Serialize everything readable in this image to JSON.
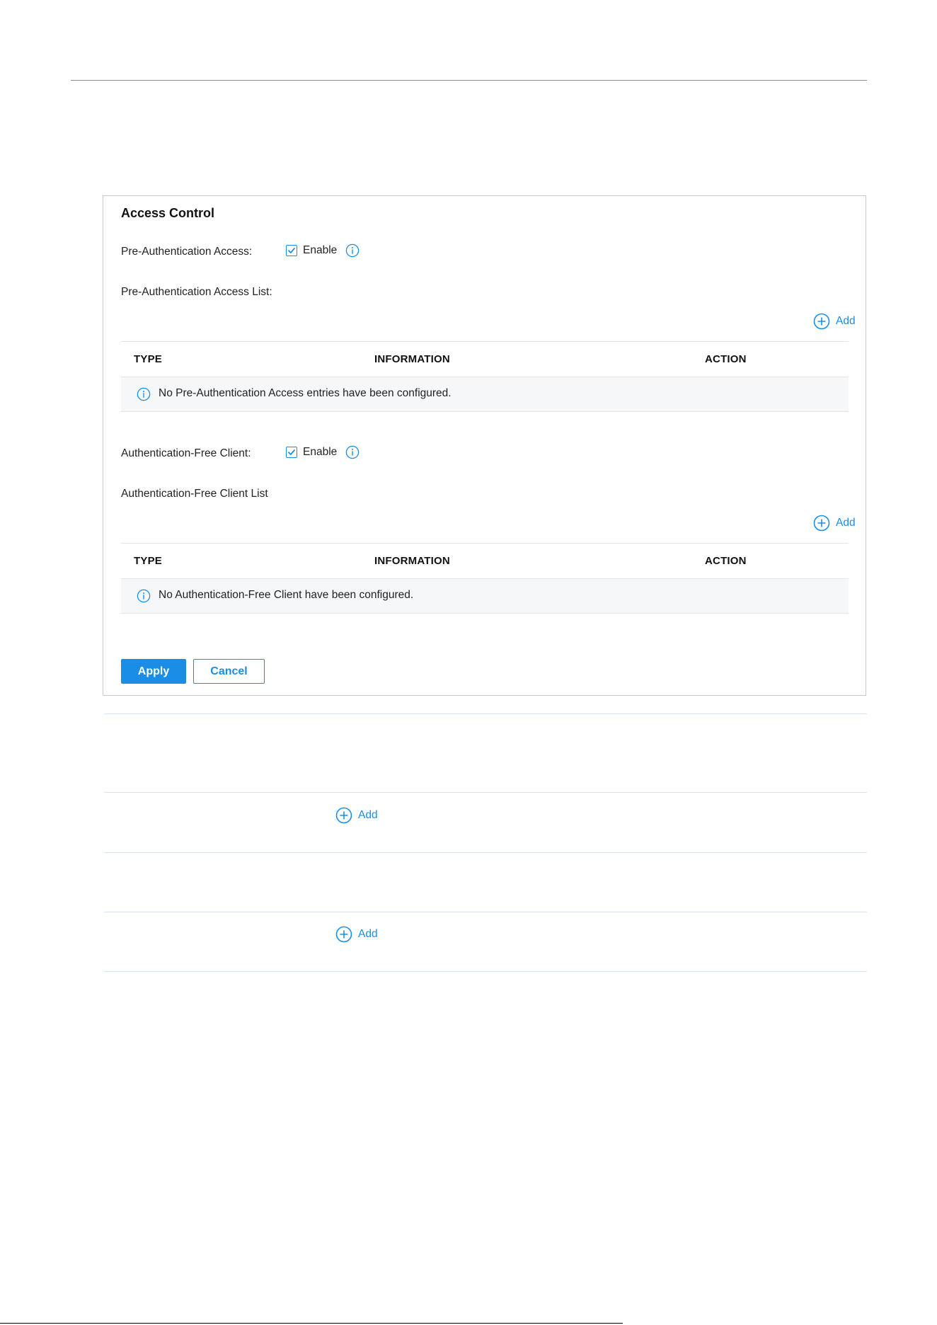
{
  "panel": {
    "title": "Access Control",
    "pre_auth": {
      "label": "Pre-Authentication Access:",
      "checkbox_label": "Enable",
      "checked": true,
      "list_label": "Pre-Authentication Access List:",
      "add_label": "Add",
      "table": {
        "columns": [
          "TYPE",
          "INFORMATION",
          "ACTION"
        ],
        "empty_message": "No Pre-Authentication Access entries have been configured."
      }
    },
    "auth_free": {
      "label": "Authentication-Free Client:",
      "checkbox_label": "Enable",
      "checked": true,
      "list_label": "Authentication-Free Client List",
      "add_label": "Add",
      "table": {
        "columns": [
          "TYPE",
          "INFORMATION",
          "ACTION"
        ],
        "empty_message": "No Authentication-Free Client have been configured."
      }
    },
    "buttons": {
      "apply": "Apply",
      "cancel": "Cancel"
    }
  },
  "lower_rows": [
    {
      "add_label": "Add"
    },
    {
      "add_label": "Add"
    }
  ],
  "colors": {
    "accent": "#1a8ee6",
    "row_bg": "#f6f7f9",
    "border": "#e4e4e4"
  },
  "icons": [
    "check-icon",
    "info-icon",
    "plus-circle-icon"
  ]
}
